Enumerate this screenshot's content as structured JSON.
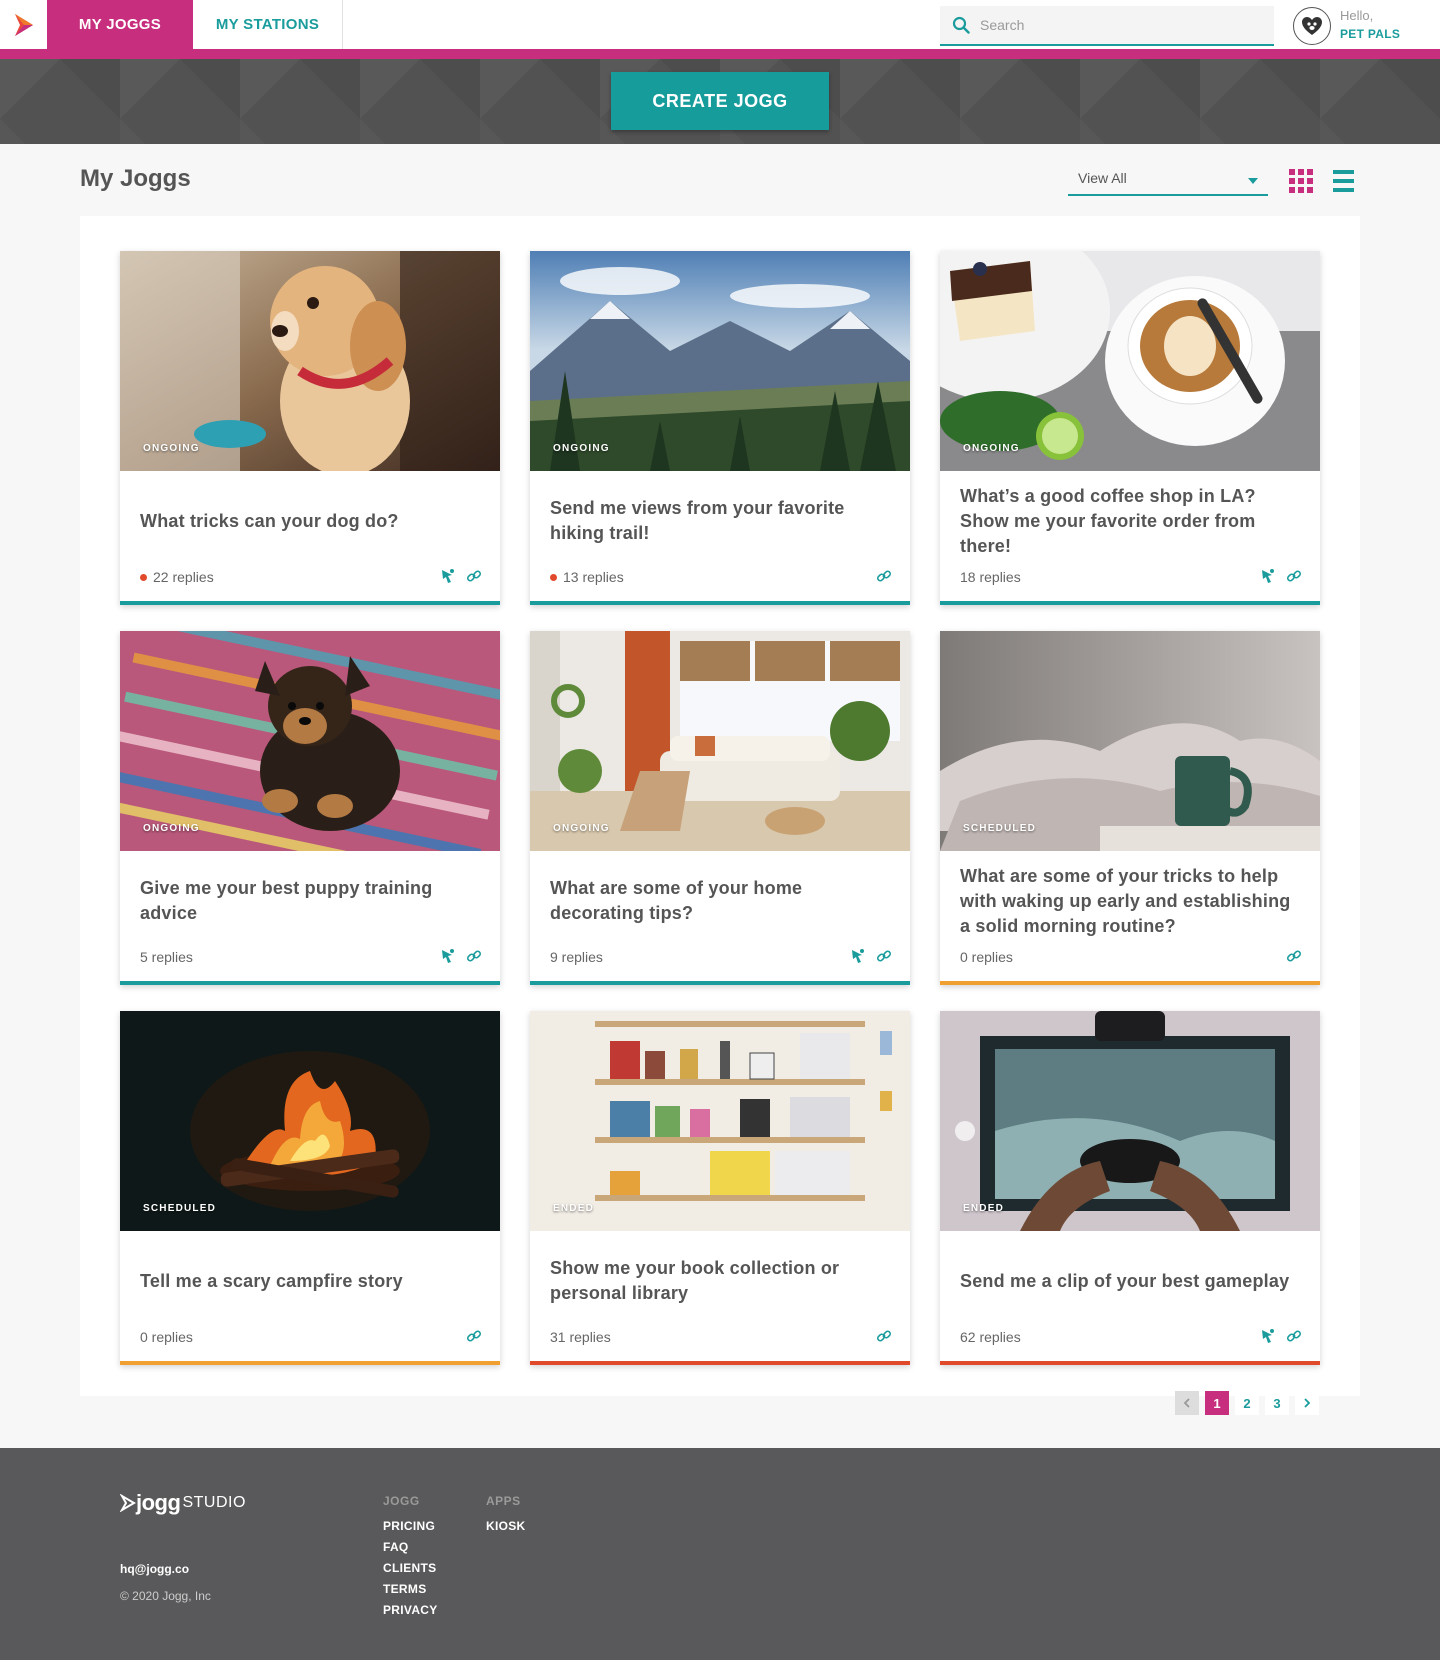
{
  "nav": {
    "tab_active": "MY JOGGS",
    "tab_inactive": "MY STATIONS",
    "search_placeholder": "Search",
    "hello": "Hello,",
    "user_name": "PET PALS"
  },
  "banner": {
    "create_label": "CREATE JOGG"
  },
  "main": {
    "title": "My Joggs",
    "view_filter": "View All"
  },
  "colors": {
    "primary": "#c72f7e",
    "accent": "#1a9c9c",
    "ongoing": "#1a9c9c",
    "scheduled": "#f0a030",
    "ended": "#e04a2a"
  },
  "cards": [
    {
      "status": "ONGOING",
      "title": "What tricks can your dog do?",
      "replies": "22 replies",
      "live": true,
      "kiosk": true
    },
    {
      "status": "ONGOING",
      "title": "Send me views from your favorite hiking trail!",
      "replies": "13 replies",
      "live": true,
      "kiosk": false
    },
    {
      "status": "ONGOING",
      "title": "What’s a good coffee shop in LA? Show me your favorite order from there!",
      "replies": "18 replies",
      "live": false,
      "kiosk": true
    },
    {
      "status": "ONGOING",
      "title": "Give me your best puppy training advice",
      "replies": "5 replies",
      "live": false,
      "kiosk": true
    },
    {
      "status": "ONGOING",
      "title": "What are some of your home decorating tips?",
      "replies": "9 replies",
      "live": false,
      "kiosk": true
    },
    {
      "status": "SCHEDULED",
      "title": "What are some of your tricks to help with waking up early and establishing a solid morning routine?",
      "replies": "0 replies",
      "live": false,
      "kiosk": false
    },
    {
      "status": "SCHEDULED",
      "title": "Tell me a scary campfire story",
      "replies": "0 replies",
      "live": false,
      "kiosk": false
    },
    {
      "status": "ENDED",
      "title": "Show me your book collection or personal library",
      "replies": "31 replies",
      "live": false,
      "kiosk": false
    },
    {
      "status": "ENDED",
      "title": "Send me a clip of your best gameplay",
      "replies": "62 replies",
      "live": false,
      "kiosk": true
    }
  ],
  "pagination": {
    "pages": [
      "1",
      "2",
      "3"
    ],
    "current": "1"
  },
  "footer": {
    "logo_jogg": "jogg",
    "logo_studio": "STUDIO",
    "email": "hq@jogg.co",
    "copyright": "© 2020 Jogg, Inc",
    "col1_head": "JOGG",
    "col1_links": [
      "PRICING",
      "FAQ",
      "CLIENTS",
      "TERMS",
      "PRIVACY"
    ],
    "col2_head": "APPS",
    "col2_links": [
      "KIOSK"
    ]
  }
}
